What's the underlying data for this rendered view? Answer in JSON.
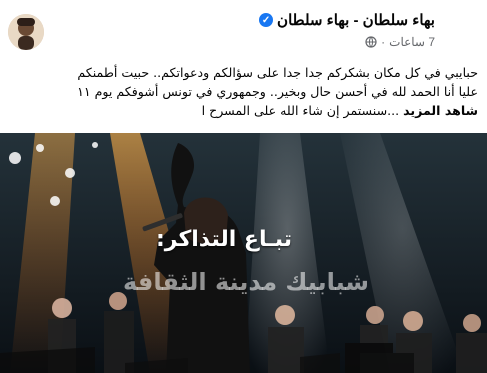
{
  "post": {
    "author": "بهاء سلطان - بهاء سلطان",
    "time": "7 ساعات",
    "privacy_icon": "globe-icon",
    "verified_icon": "verified-badge-icon",
    "text_lines": [
      "حبايبي في كل مكان بشكركم جدا جدا على سؤالكم ودعواتكم.. حبيت أطمنكم",
      "عليا أنا الحمد لله في أحسن حال وبخير.. وجمهوري في تونس أشوفكم يوم ١١",
      "...سنستمر إن شاء الله على المسرح ا",
      "شاهد المزيد"
    ]
  },
  "media": {
    "overlay_title": "تبـاع التذاكر:",
    "overlay_subtitle": "شبابيك مدينة الثقافة"
  },
  "colors": {
    "facebook_blue": "#1877f2",
    "secondary_text": "#65676b",
    "stage_orange": "#ff7a18"
  }
}
